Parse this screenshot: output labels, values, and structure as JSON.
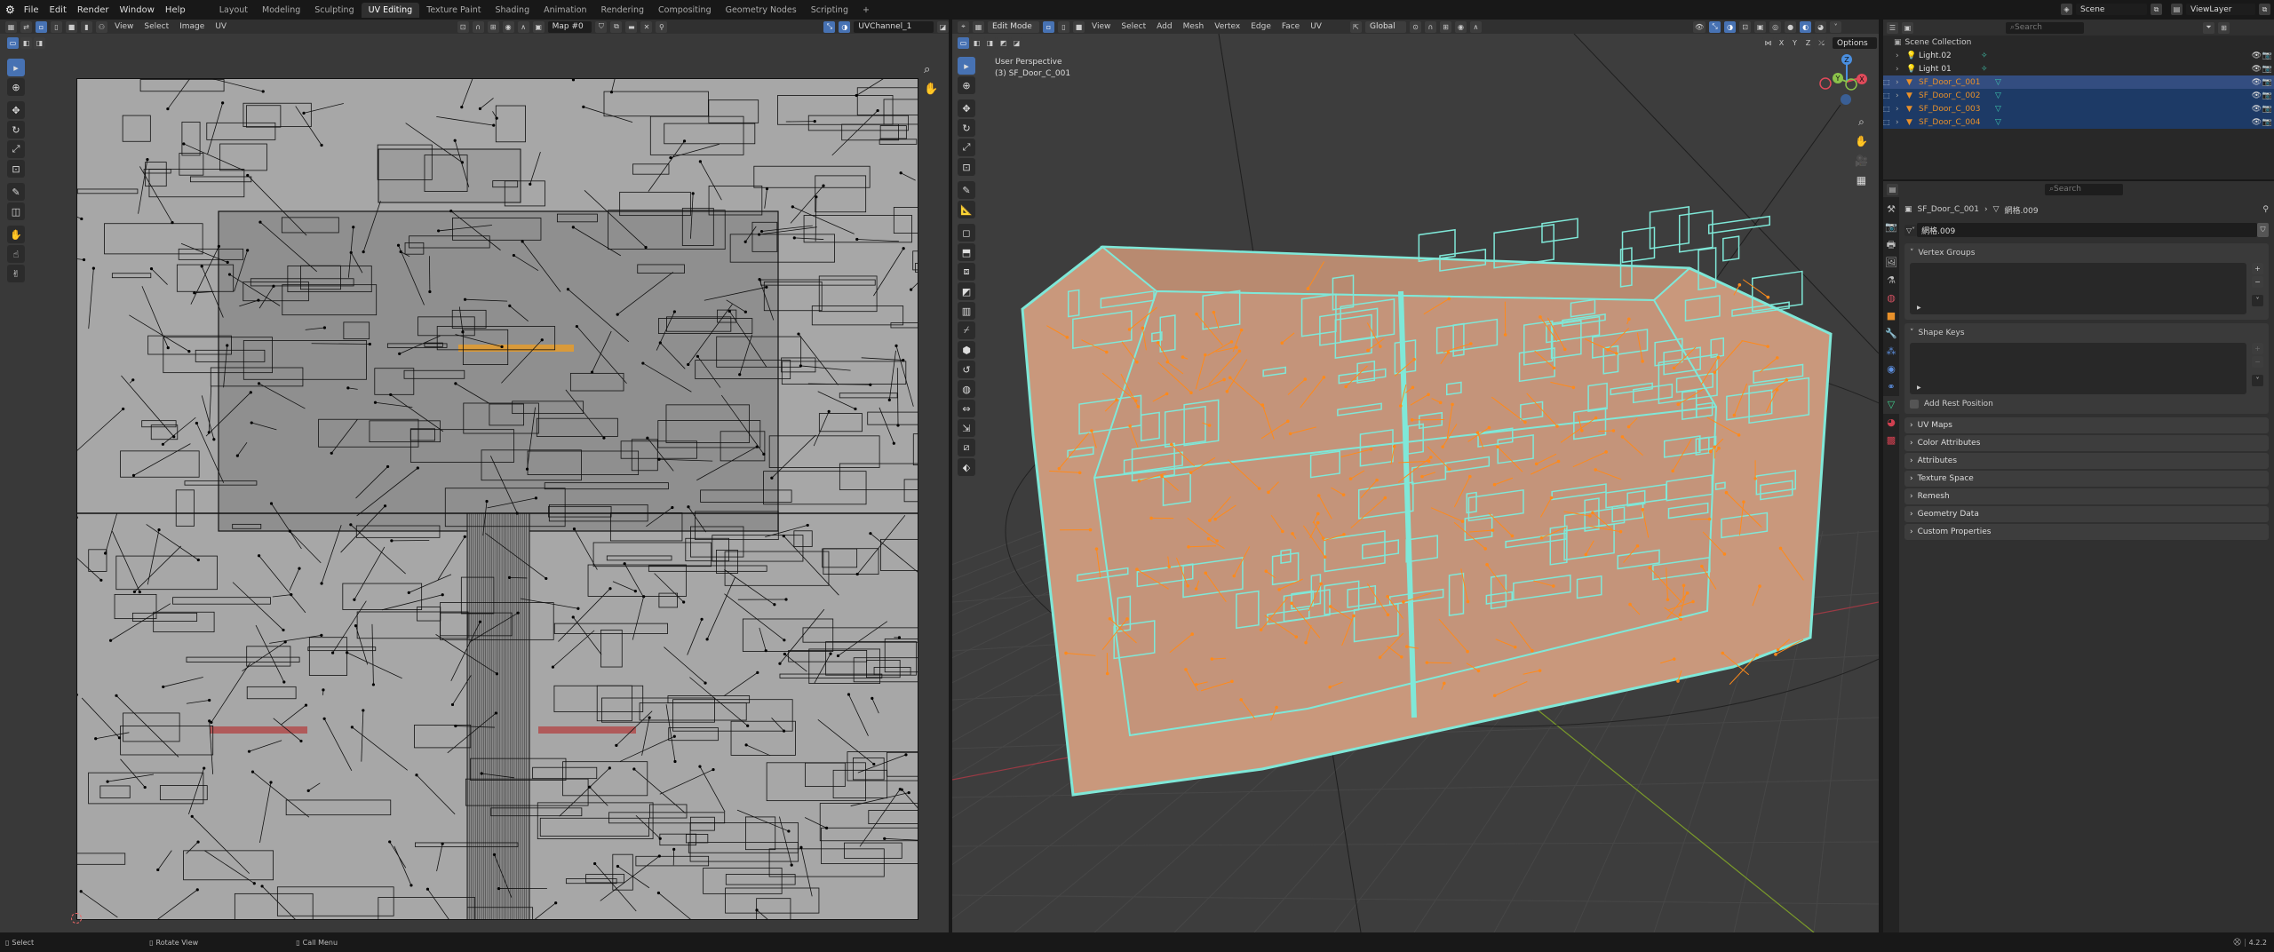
{
  "app": {
    "menu": [
      "File",
      "Edit",
      "Render",
      "Window",
      "Help"
    ],
    "workspaces": [
      "Layout",
      "Modeling",
      "Sculpting",
      "UV Editing",
      "Texture Paint",
      "Shading",
      "Animation",
      "Rendering",
      "Compositing",
      "Geometry Nodes",
      "Scripting"
    ],
    "active_workspace": "UV Editing",
    "add_workspace": "+",
    "scene": "Scene",
    "view_layer": "ViewLayer"
  },
  "uv_editor": {
    "menus": [
      "View",
      "Select",
      "Image",
      "UV"
    ],
    "image_name": "Map #0",
    "uv_map": "UVChannel_1",
    "tools": [
      "select-box",
      "cursor",
      "move",
      "rotate",
      "scale",
      "transform",
      "annotate",
      "rip",
      "grab",
      "relax",
      "pinch"
    ]
  },
  "viewport": {
    "mode": "Edit Mode",
    "menus": [
      "View",
      "Select",
      "Add",
      "Mesh",
      "Vertex",
      "Edge",
      "Face",
      "UV"
    ],
    "orientation": "Global",
    "view_name": "User Perspective",
    "object_label": "(3) SF_Door_C_001",
    "options": "Options",
    "axes": [
      "X",
      "Y",
      "Z"
    ],
    "gizmo": {
      "x": "X",
      "y": "Y",
      "z": "Z"
    },
    "colors": {
      "face": "#c9987c",
      "edge": "#7fe8d8",
      "vertex": "#ff8a1a"
    }
  },
  "outliner": {
    "search_placeholder": "Search",
    "root": "Scene Collection",
    "items": [
      {
        "name": "Light.02",
        "type": "light",
        "selected": false
      },
      {
        "name": "Light 01",
        "type": "light",
        "selected": false
      },
      {
        "name": "SF_Door_C_001",
        "type": "mesh",
        "selected": true,
        "active": true
      },
      {
        "name": "SF_Door_C_002",
        "type": "mesh",
        "selected": true
      },
      {
        "name": "SF_Door_C_003",
        "type": "mesh",
        "selected": true
      },
      {
        "name": "SF_Door_C_004",
        "type": "mesh",
        "selected": true
      }
    ]
  },
  "properties": {
    "search_placeholder": "Search",
    "breadcrumb_object": "SF_Door_C_001",
    "breadcrumb_mesh": "網格.009",
    "mesh_name": "網格.009",
    "panels": {
      "vertex_groups": "Vertex Groups",
      "shape_keys": "Shape Keys",
      "add_rest_position": "Add Rest Position"
    },
    "collapsed": [
      "UV Maps",
      "Color Attributes",
      "Attributes",
      "Texture Space",
      "Remesh",
      "Geometry Data",
      "Custom Properties"
    ]
  },
  "status": {
    "select": "Select",
    "rotate": "Rotate View",
    "menu": "Call Menu",
    "version": "4.2.2"
  }
}
